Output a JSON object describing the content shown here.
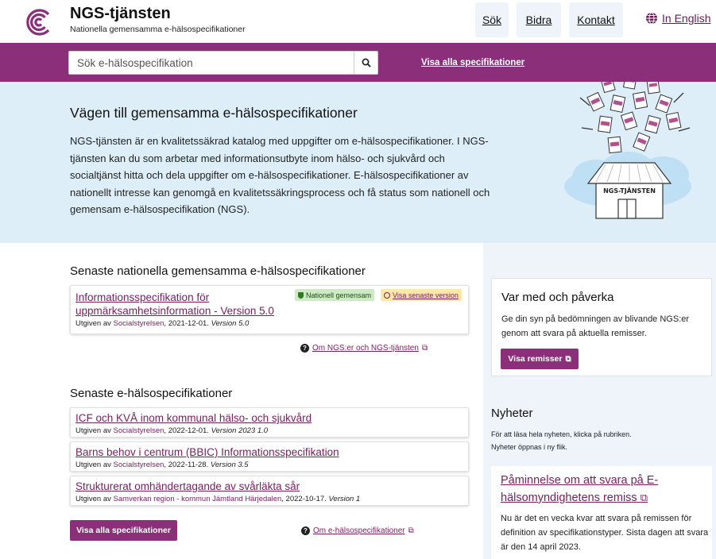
{
  "header": {
    "title": "NGS-tjänsten",
    "subtitle": "Nationella gemensamma e-hälsospecifikationer",
    "nav": [
      "Sök",
      "Bidra",
      "Kontakt"
    ],
    "language": "In English"
  },
  "search": {
    "placeholder": "Sök e-hälsospecifikation",
    "show_all": "Visa alla specifikationer"
  },
  "hero": {
    "heading": "Vägen till gemensamma e-hälsospecifikationer",
    "text": "NGS-tjänsten är en kvalitetssäkrad katalog med uppgifter om e-hälsospecifikationer. I NGS-tjänsten kan du som arbetar med informationsutbyte inom hälso- och sjukvård och socialtjänst hitta och dela uppgifter om e-hälsospecifikationer. E-hälsospecifikationer av nationellt intresse kan genomgå en kvalitetssäkringsprocess och få status som nationell och gemensam e-hälsospecifikation (NGS).",
    "illustration_label": "NGS-TJÄNSTEN"
  },
  "national": {
    "heading": "Senaste nationella gemensamma e-hälsospecifikationer",
    "item": {
      "title": "Informationsspecifikation för uppmärksamhetsinformation - Version 5.0",
      "publisher_prefix": "Utgiven av ",
      "publisher": "Socialstyrelsen",
      "date": ", 2021-12-01. ",
      "version": "Version 5.0",
      "badge_status": "Nationell gemensam",
      "badge_latest": "Visa senaste version"
    },
    "info_link": "Om NGS:er och NGS-tjänsten"
  },
  "latest": {
    "heading": "Senaste e-hälsospecifikationer",
    "items": [
      {
        "title": "ICF och KVÅ inom kommunal hälso- och sjukvård",
        "publisher_prefix": "Utgiven av ",
        "publisher": "Socialstyrelsen",
        "date": ", 2022-12-01. ",
        "version": "Version 2023 1.0"
      },
      {
        "title": "Barns behov i centrum (BBIC) Informationsspecifikation",
        "publisher_prefix": "Utgiven av ",
        "publisher": "Socialstyrelsen",
        "date": ", 2022-11-28. ",
        "version": "Version 3.5"
      },
      {
        "title": "Strukturerat omhändertagande av svårläkta sår",
        "publisher_prefix": "Utgiven av ",
        "publisher": "Samverkan region - kommun Jämtland Härjedalen",
        "date": ", 2022-10-17. ",
        "version": "Version 1"
      }
    ],
    "show_all_button": "Visa alla specifikationer",
    "info_link": "Om e-hälsospecifikationer"
  },
  "participate": {
    "heading": "Var med och påverka",
    "text": "Ge din syn på bedömningen av blivande NGS:er genom att svara på aktuella remisser.",
    "button": "Visa remisser"
  },
  "news": {
    "heading": "Nyheter",
    "note_line1": "För att läsa hela nyheten, klicka på rubriken.",
    "note_line2": "Nyheter öppnas i ny flik.",
    "item_title": "Påminnelse om att svara på E-hälsomyndighetens remiss",
    "item_body": "Nu är det en vecka kvar att svara på remissen för definition av specifikationstyper. Sista dagen att svara är den 14 april 2023."
  },
  "colors": {
    "brand_purple": "#8b2f7a",
    "link_purple": "#7a2060",
    "hero_blue": "#ddeef9",
    "badge_green": "#cfe9c6",
    "badge_yellow": "#fbe7a6"
  }
}
